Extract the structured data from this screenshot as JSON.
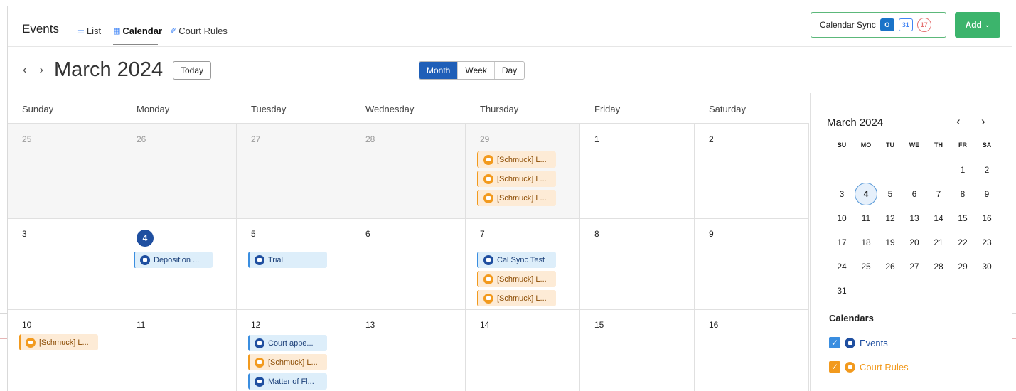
{
  "header": {
    "title": "Events",
    "tabs": [
      {
        "label": "List",
        "icon": "list-icon"
      },
      {
        "label": "Calendar",
        "icon": "calendar-icon",
        "active": true
      },
      {
        "label": "Court Rules",
        "icon": "gavel-icon"
      }
    ],
    "calendar_sync_label": "Calendar Sync",
    "sync_icons": [
      "outlook-icon",
      "google-calendar-icon",
      "ical-icon"
    ],
    "gcal_text": "31",
    "ical_text": "17",
    "add_label": "Add"
  },
  "toolbar": {
    "prev_symbol": "‹",
    "next_symbol": "›",
    "month_title": "March 2024",
    "today_label": "Today",
    "views": [
      {
        "label": "Month",
        "active": true
      },
      {
        "label": "Week"
      },
      {
        "label": "Day"
      }
    ]
  },
  "calendar": {
    "weekdays": [
      "Sunday",
      "Monday",
      "Tuesday",
      "Wednesday",
      "Thursday",
      "Friday",
      "Saturday"
    ],
    "weeks": [
      {
        "days": [
          {
            "num": "25",
            "past": true,
            "events": []
          },
          {
            "num": "26",
            "past": true,
            "events": []
          },
          {
            "num": "27",
            "past": true,
            "events": []
          },
          {
            "num": "28",
            "past": true,
            "events": []
          },
          {
            "num": "29",
            "past": true,
            "events": [
              {
                "label": "[Schmuck] L...",
                "kind": "orange"
              },
              {
                "label": "[Schmuck] L...",
                "kind": "orange"
              },
              {
                "label": "[Schmuck] L...",
                "kind": "orange"
              }
            ]
          },
          {
            "num": "1",
            "events": []
          },
          {
            "num": "2",
            "events": []
          }
        ]
      },
      {
        "days": [
          {
            "num": "3",
            "events": []
          },
          {
            "num": "4",
            "today": true,
            "events": [
              {
                "label": "Deposition ...",
                "kind": "blue"
              }
            ]
          },
          {
            "num": "5",
            "events": [
              {
                "label": "Trial",
                "kind": "blue"
              }
            ]
          },
          {
            "num": "6",
            "events": []
          },
          {
            "num": "7",
            "events": [
              {
                "label": "Cal Sync Test",
                "kind": "blue"
              },
              {
                "label": "[Schmuck] L...",
                "kind": "orange"
              },
              {
                "label": "[Schmuck] L...",
                "kind": "orange"
              }
            ]
          },
          {
            "num": "8",
            "events": []
          },
          {
            "num": "9",
            "events": []
          }
        ]
      },
      {
        "days": [
          {
            "num": "10",
            "events": [
              {
                "label": "[Schmuck] L...",
                "kind": "orange"
              }
            ]
          },
          {
            "num": "11",
            "events": []
          },
          {
            "num": "12",
            "events": [
              {
                "label": "Court appe...",
                "kind": "blue"
              },
              {
                "label": "[Schmuck] L...",
                "kind": "orange"
              },
              {
                "label": "Matter of Fl...",
                "kind": "blue"
              }
            ]
          },
          {
            "num": "13",
            "events": []
          },
          {
            "num": "14",
            "events": []
          },
          {
            "num": "15",
            "events": []
          },
          {
            "num": "16",
            "events": []
          }
        ]
      }
    ]
  },
  "mini_calendar": {
    "title": "March 2024",
    "prev_symbol": "‹",
    "next_symbol": "›",
    "weekdays": [
      "SU",
      "MO",
      "TU",
      "WE",
      "TH",
      "FR",
      "SA"
    ],
    "first_weekday_index": 5,
    "days_in_month": 31,
    "selected_day": 4
  },
  "calendars": {
    "header": "Calendars",
    "items": [
      {
        "label": "Events",
        "color": "#1f4fa0",
        "checked": true
      },
      {
        "label": "Court Rules",
        "color": "#f29a1e",
        "checked": true
      }
    ]
  },
  "colors": {
    "accent_blue": "#1f5fb8",
    "add_green": "#3cb46c",
    "event_blue": "#3a8ee0",
    "event_orange": "#f29a1e"
  }
}
